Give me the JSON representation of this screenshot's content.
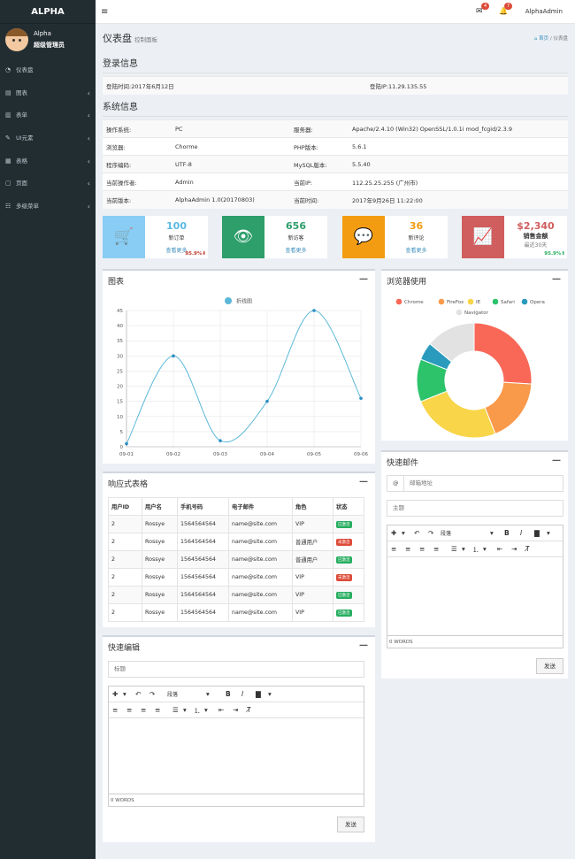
{
  "sidebar": {
    "brand": "ALPHA",
    "user": {
      "name": "Alpha",
      "role": "超级管理员"
    },
    "items": [
      {
        "icon": "◔",
        "label": "仪表盘",
        "chevron": ""
      },
      {
        "icon": "▤",
        "label": "图表",
        "chevron": "‹"
      },
      {
        "icon": "▥",
        "label": "表单",
        "chevron": "‹"
      },
      {
        "icon": "✎",
        "label": "UI元素",
        "chevron": "‹"
      },
      {
        "icon": "▦",
        "label": "表格",
        "chevron": "‹"
      },
      {
        "icon": "▢",
        "label": "页面",
        "chevron": "‹"
      },
      {
        "icon": "☷",
        "label": "多级菜单",
        "chevron": "‹"
      }
    ]
  },
  "topbar": {
    "menu_icon": "≡",
    "mail_icon": "✉",
    "mail_count": "4",
    "bell_icon": "🔔",
    "bell_count": "7",
    "user": "AlphaAdmin"
  },
  "page": {
    "title": "仪表盘",
    "subtitle": "控制面板",
    "breadcrumb": {
      "home_icon": "⌂",
      "home": "首页",
      "sep": "/",
      "current": "仪表盘"
    }
  },
  "login_info": {
    "heading": "登录信息",
    "time": "登陆时间:2017年6月12日",
    "ip": "登陆IP:11.29.135.55"
  },
  "system_info": {
    "heading": "系统信息",
    "rows": [
      [
        "操作系统:",
        "PC",
        "服务器:",
        "Apache/2.4.10 (Win32) OpenSSL/1.0.1i mod_fcgid/2.3.9"
      ],
      [
        "浏览器:",
        "Chorme",
        "PHP版本:",
        "5.6.1"
      ],
      [
        "程序编码:",
        "UTF-8",
        "MySQL版本:",
        "5.5.40"
      ],
      [
        "当前操作者:",
        "Admin",
        "当前IP:",
        "112.25.25.255 (广州市)"
      ],
      [
        "当前版本:",
        "AlphaAdmin 1.0(20170803)",
        "当前时间:",
        "2017年9月26日 11:22:00"
      ]
    ]
  },
  "stats": [
    {
      "icon": "🛒",
      "value": "100",
      "label": "新订单",
      "link": "查看更多",
      "pct": "95.9%",
      "pct_arrow": "⬇",
      "color": "#89cdf4",
      "value_color": "#5bb8e4",
      "pct_color": "#c0392b"
    },
    {
      "icon": "👁",
      "value": "656",
      "label": "新访客",
      "link": "查看更多",
      "pct": "",
      "pct_arrow": "",
      "color": "#2e9e6b",
      "value_color": "#2e9e6b",
      "pct_color": "#2e9e6b"
    },
    {
      "icon": "💬",
      "value": "36",
      "label": "新评论",
      "link": "查看更多",
      "pct": "",
      "pct_arrow": "",
      "color": "#f39c12",
      "value_color": "#f39c12",
      "pct_color": "#f39c12"
    },
    {
      "icon": "📈",
      "value": "$2,340",
      "label": "销售金额",
      "link": "最近30天",
      "pct": "95.9%",
      "pct_arrow": "⬆",
      "color": "#d05e5e",
      "value_color": "#d05e5e",
      "pct_color": "#27ae60"
    }
  ],
  "line_panel": {
    "title": "图表",
    "collapse": "—"
  },
  "chart_data": [
    {
      "type": "line",
      "title": "",
      "legend": [
        "折线图"
      ],
      "categories": [
        "09-01",
        "09-02",
        "09-03",
        "09-04",
        "09-05",
        "09-06"
      ],
      "series": [
        {
          "name": "折线图",
          "values": [
            1,
            30,
            2,
            15,
            45,
            16
          ]
        }
      ],
      "yticks": [
        "0",
        "5",
        "10",
        "15",
        "20",
        "25",
        "30",
        "35",
        "40",
        "45"
      ],
      "ylim": [
        0,
        45
      ],
      "grid": true,
      "color": "#5bb8d8"
    },
    {
      "type": "pie",
      "title": "",
      "legend": [
        "Chrome",
        "FireFox",
        "IE",
        "Safari",
        "Opera",
        "Navigator"
      ],
      "values": [
        26,
        18,
        25,
        12,
        5,
        14
      ],
      "colors": [
        "#f96757",
        "#f9994a",
        "#f8d549",
        "#2cc36b",
        "#2a9bbd",
        "#e2e2e2"
      ],
      "legend_position": "top"
    }
  ],
  "browser_panel": {
    "title": "浏览器使用",
    "collapse": "—"
  },
  "table_panel": {
    "title": "响应式表格",
    "collapse": "—",
    "headers": [
      "用户ID",
      "用户名",
      "手机号码",
      "电子邮件",
      "角色",
      "状态"
    ],
    "rows": [
      {
        "id": "2",
        "name": "Rossye",
        "phone": "1564564564",
        "email": "name@site.com",
        "role": "VIP",
        "status": "已激活",
        "status_color": "#27ae60"
      },
      {
        "id": "2",
        "name": "Rossye",
        "phone": "1564564564",
        "email": "name@site.com",
        "role": "普通用户",
        "status": "未激活",
        "status_color": "#dd4b39"
      },
      {
        "id": "2",
        "name": "Rossye",
        "phone": "1564564564",
        "email": "name@site.com",
        "role": "普通用户",
        "status": "已激活",
        "status_color": "#27ae60"
      },
      {
        "id": "2",
        "name": "Rossye",
        "phone": "1564564564",
        "email": "name@site.com",
        "role": "VIP",
        "status": "未激活",
        "status_color": "#dd4b39"
      },
      {
        "id": "2",
        "name": "Rossye",
        "phone": "1564564564",
        "email": "name@site.com",
        "role": "VIP",
        "status": "已激活",
        "status_color": "#27ae60"
      },
      {
        "id": "2",
        "name": "Rossye",
        "phone": "1564564564",
        "email": "name@site.com",
        "role": "VIP",
        "status": "已激活",
        "status_color": "#27ae60"
      }
    ]
  },
  "mail_panel": {
    "title": "快速邮件",
    "collapse": "—",
    "at_icon": "@",
    "email_placeholder": "邮箱地址",
    "subject_placeholder": "主题",
    "words": "0 WORDS",
    "send": "发送"
  },
  "edit_panel": {
    "title": "快速编辑",
    "collapse": "—",
    "title_placeholder": "标题",
    "words": "0 WORDS",
    "send": "发送"
  },
  "editor_toolbar": {
    "add": "✚",
    "caret": "▾",
    "undo": "↶",
    "redo": "↷",
    "format": "段落",
    "bold": "B",
    "italic": "I",
    "color": "▇",
    "align_left": "≡",
    "align_center": "≡",
    "align_right": "≡",
    "justify": "≡",
    "bullets": "☰",
    "numbers": "⒈",
    "outdent": "⇤",
    "indent": "⇥",
    "clear": "T̸"
  }
}
